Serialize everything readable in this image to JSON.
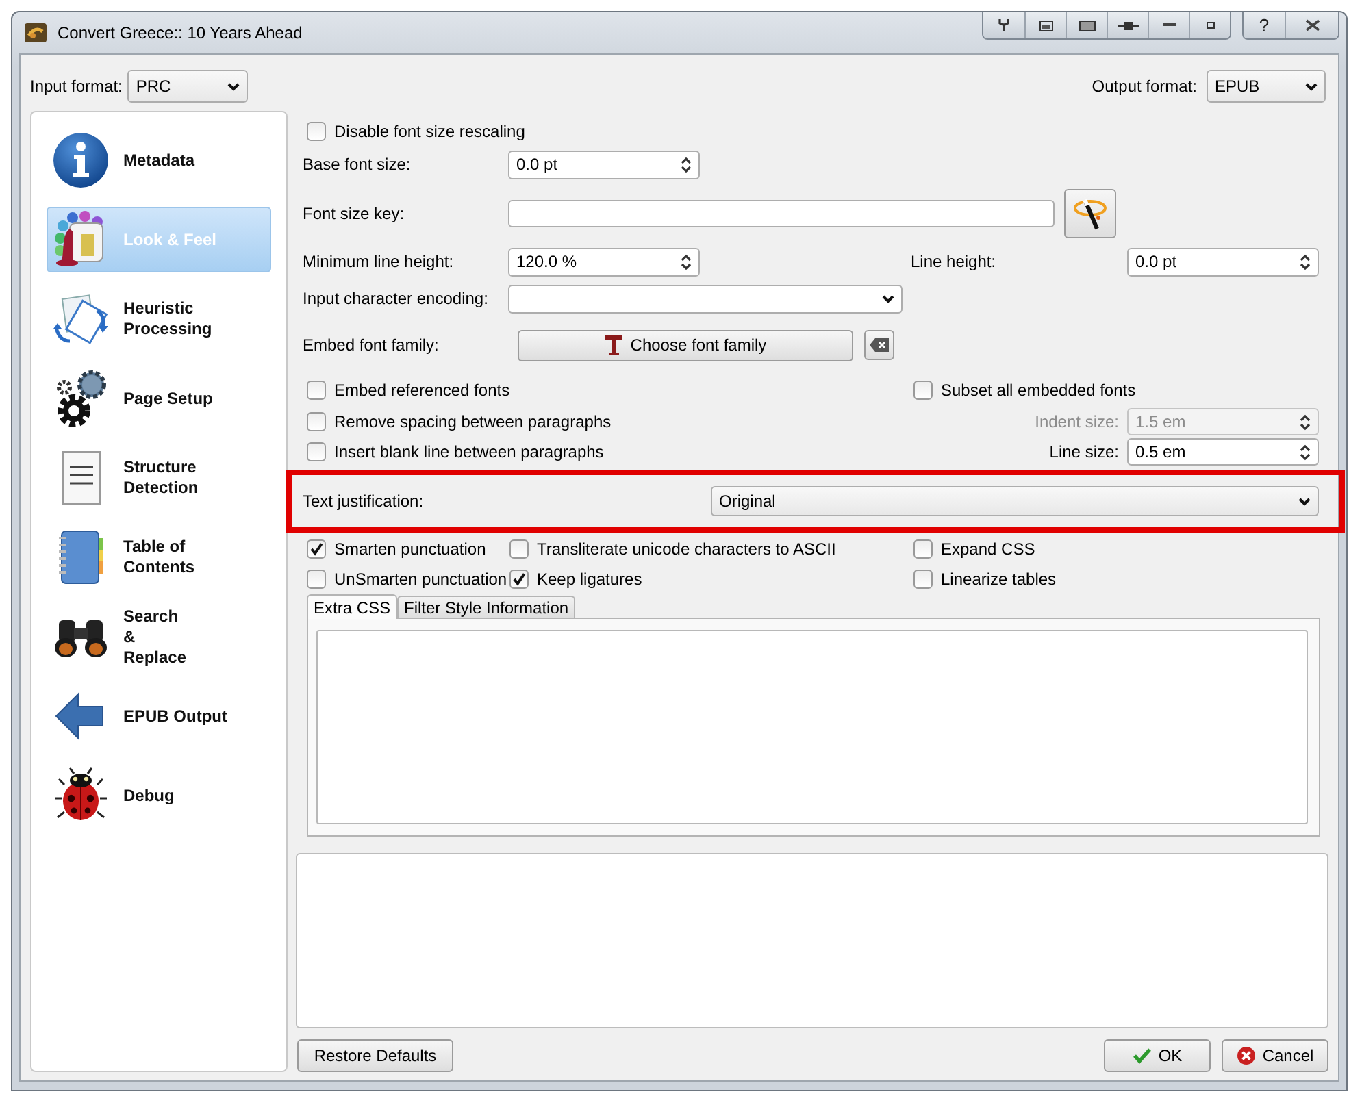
{
  "window": {
    "title": "Convert Greece:: 10 Years Ahead",
    "help": "?"
  },
  "input_format": {
    "label": "Input format:",
    "value": "PRC"
  },
  "output_format": {
    "label": "Output format:",
    "value": "EPUB"
  },
  "sidebar": {
    "items": [
      {
        "lines": [
          "Metadata"
        ],
        "selected": false
      },
      {
        "lines": [
          "Look & Feel"
        ],
        "selected": true
      },
      {
        "lines": [
          "Heuristic",
          "Processing"
        ],
        "selected": false
      },
      {
        "lines": [
          "Page Setup"
        ],
        "selected": false
      },
      {
        "lines": [
          "Structure",
          "Detection"
        ],
        "selected": false
      },
      {
        "lines": [
          "Table of",
          "Contents"
        ],
        "selected": false
      },
      {
        "lines": [
          "Search",
          "&",
          "Replace"
        ],
        "selected": false
      },
      {
        "lines": [
          "EPUB Output"
        ],
        "selected": false
      },
      {
        "lines": [
          "Debug"
        ],
        "selected": false
      }
    ]
  },
  "look_and_feel": {
    "disable_font_size_rescaling": {
      "label": "Disable font size rescaling",
      "checked": false
    },
    "base_font_size": {
      "label": "Base font size:",
      "value": "0.0 pt"
    },
    "font_size_key": {
      "label": "Font size key:"
    },
    "minimum_line_height": {
      "label": "Minimum line height:",
      "value": "120.0 %"
    },
    "line_height": {
      "label": "Line height:",
      "value": "0.0 pt"
    },
    "input_character_encoding": {
      "label": "Input character encoding:"
    },
    "embed_font_family": {
      "label": "Embed font family:",
      "button": "Choose font family"
    },
    "embed_referenced_fonts": {
      "label": "Embed referenced fonts",
      "checked": false
    },
    "subset_all_embedded_fonts": {
      "label": "Subset all embedded fonts",
      "checked": false
    },
    "remove_spacing_between_paragraphs": {
      "label": "Remove spacing between paragraphs",
      "checked": false
    },
    "indent_size": {
      "label": "Indent size:",
      "value": "1.5 em",
      "disabled": true
    },
    "insert_blank_line_between_paragraphs": {
      "label": "Insert blank line between paragraphs",
      "checked": false
    },
    "line_size": {
      "label": "Line size:",
      "value": "0.5 em",
      "disabled": false
    },
    "text_justification": {
      "label": "Text justification:",
      "value": "Original",
      "highlighted": true
    },
    "smarten_punctuation": {
      "label": "Smarten punctuation",
      "checked": true
    },
    "transliterate_unicode": {
      "label": "Transliterate unicode characters to ASCII",
      "checked": false
    },
    "expand_css": {
      "label": "Expand CSS",
      "checked": false
    },
    "unsmarten_punctuation": {
      "label": "UnSmarten punctuation",
      "checked": false
    },
    "keep_ligatures": {
      "label": "Keep ligatures",
      "checked": true
    },
    "linearize_tables": {
      "label": "Linearize tables",
      "checked": false
    },
    "tabs": [
      {
        "label": "Extra CSS",
        "selected": true
      },
      {
        "label": "Filter Style Information",
        "selected": false
      }
    ]
  },
  "buttons": {
    "restore_defaults": "Restore Defaults",
    "ok": "OK",
    "cancel": "Cancel"
  }
}
